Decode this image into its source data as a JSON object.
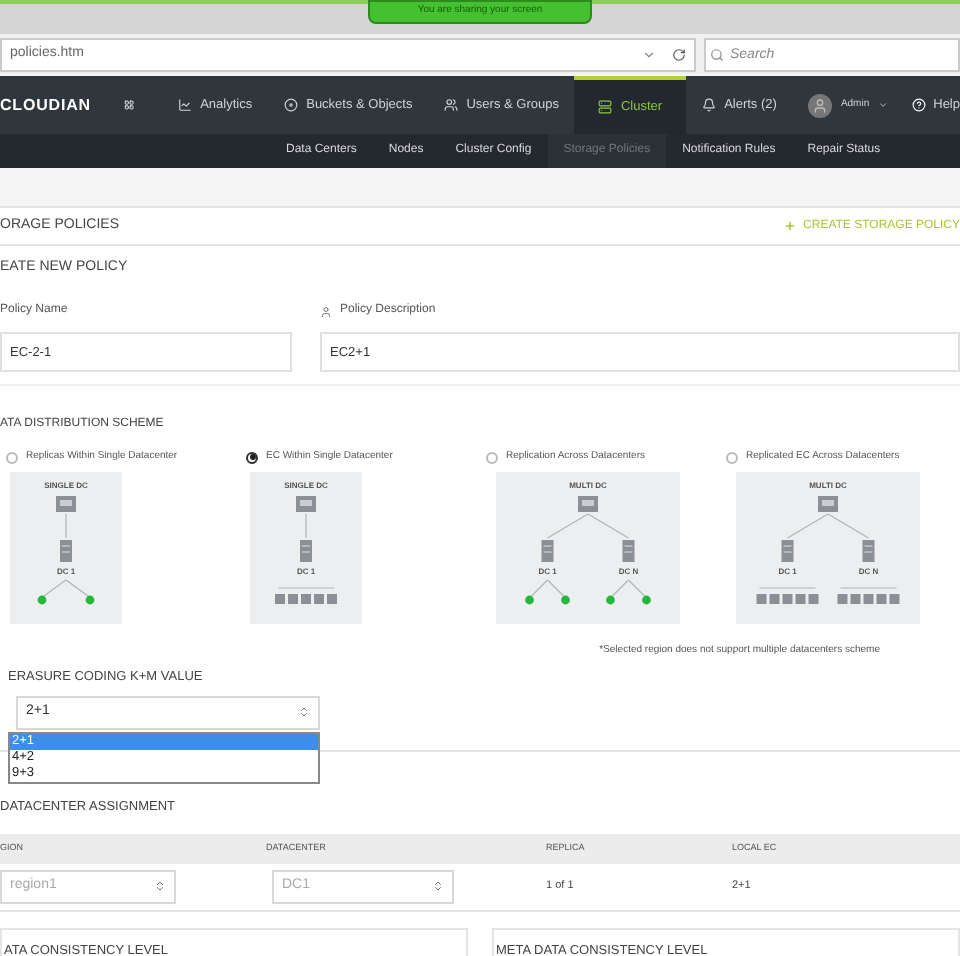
{
  "banner": {
    "text": "You are sharing your screen"
  },
  "browser": {
    "url": "policies.htm",
    "search": {
      "placeholder": "Search"
    }
  },
  "nav": {
    "logo": "CLOUDIAN",
    "items": [
      {
        "kind": "analytics",
        "label": "Analytics",
        "selected": false
      },
      {
        "kind": "buckets",
        "label": "Buckets & Objects",
        "selected": false
      },
      {
        "kind": "users",
        "label": "Users & Groups",
        "selected": false
      },
      {
        "kind": "cluster",
        "label": "Cluster",
        "selected": true
      },
      {
        "kind": "alerts",
        "label": "Alerts (2)",
        "selected": false
      }
    ],
    "user": "Admin",
    "help": "Help"
  },
  "subnav": [
    {
      "label": "Data Centers",
      "selected": false
    },
    {
      "label": "Nodes",
      "selected": false
    },
    {
      "label": "Cluster Config",
      "selected": false
    },
    {
      "label": "Storage Policies",
      "selected": true
    },
    {
      "label": "Notification Rules",
      "selected": false
    },
    {
      "label": "Repair Status",
      "selected": false
    }
  ],
  "page": {
    "title": "ORAGE POLICIES",
    "action": "CREATE STORAGE POLICY"
  },
  "form": {
    "title": "EATE NEW POLICY",
    "name": {
      "label": "Policy Name",
      "value": "EC-2-1"
    },
    "description": {
      "label": "Policy Description",
      "value": "EC2+1"
    }
  },
  "distribution": {
    "title": "ATA DISTRIBUTION SCHEME",
    "schemes": [
      {
        "label": "Replicas Within Single Datacenter",
        "selected": false,
        "top": "SINGLE DC",
        "dcs": [
          "DC 1"
        ],
        "kind": "replica"
      },
      {
        "label": "EC Within Single Datacenter",
        "selected": true,
        "top": "SINGLE DC",
        "dcs": [
          "DC 1"
        ],
        "kind": "ec"
      },
      {
        "label": "Replication Across Datacenters",
        "selected": false,
        "top": "MULTI DC",
        "dcs": [
          "DC 1",
          "DC N"
        ],
        "kind": "replica"
      },
      {
        "label": "Replicated EC Across Datacenters",
        "selected": false,
        "top": "MULTI DC",
        "dcs": [
          "DC 1",
          "DC N"
        ],
        "kind": "ec"
      }
    ],
    "note": "*Selected region does not support multiple datacenters scheme"
  },
  "erasure": {
    "title": "ERASURE CODING K+M VALUE",
    "value": "2+1",
    "options": [
      {
        "label": "2+1",
        "selected": true
      },
      {
        "label": "4+2",
        "selected": false
      },
      {
        "label": "9+3",
        "selected": false
      }
    ]
  },
  "assignment": {
    "title": "DATACENTER ASSIGNMENT",
    "columns": [
      "GION",
      "DATACENTER",
      "REPLICA",
      "LOCAL EC"
    ],
    "rows": [
      {
        "region": "region1",
        "datacenter": "DC1",
        "replica": "1 of 1",
        "local_ec": "2+1"
      }
    ]
  },
  "consistency": [
    "ATA CONSISTENCY LEVEL",
    "META DATA CONSISTENCY LEVEL"
  ]
}
